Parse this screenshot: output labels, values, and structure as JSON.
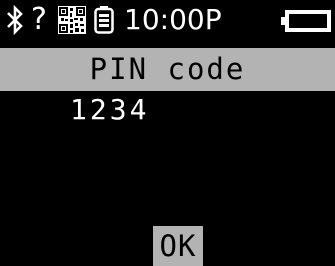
{
  "status_bar": {
    "icons": [
      "bluetooth-icon",
      "question-mark-icon",
      "qr-code-icon",
      "battery-small-icon",
      "battery-icon"
    ],
    "unknown_symbol": "?",
    "time": "10:00P"
  },
  "header": {
    "title": "PIN code"
  },
  "pin": {
    "value": "1234"
  },
  "actions": {
    "ok_label": "OK"
  },
  "colors": {
    "background": "#000000",
    "foreground": "#ffffff",
    "highlight": "#b3b3b3"
  }
}
